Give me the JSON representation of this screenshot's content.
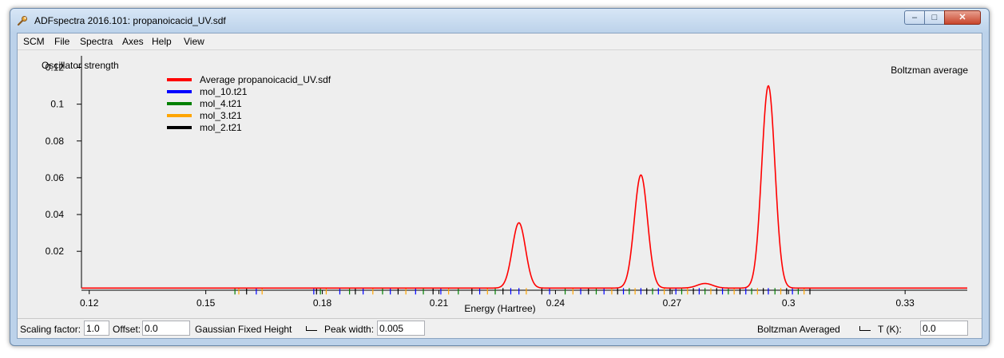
{
  "window": {
    "title": "ADFspectra 2016.101: propanoicacid_UV.sdf"
  },
  "window_controls": {
    "minimize": "–",
    "maximize": "□",
    "close": "✕"
  },
  "menu": [
    "SCM",
    "File",
    "Spectra",
    "Axes",
    "Help",
    "View"
  ],
  "icons": {
    "app": "wrench-icon"
  },
  "legend": [
    {
      "label": "Average propanoicacid_UV.sdf",
      "color": "#ff0000"
    },
    {
      "label": "mol_10.t21",
      "color": "#0000ff"
    },
    {
      "label": "mol_4.t21",
      "color": "#008000"
    },
    {
      "label": "mol_3.t21",
      "color": "#ffa500"
    },
    {
      "label": "mol_2.t21",
      "color": "#000000"
    }
  ],
  "plot": {
    "mode_label": "Boltzman average"
  },
  "chart_data": {
    "type": "line",
    "xlabel": "Energy (Hartree)",
    "ylabel": "Oscillator strength",
    "xlim": [
      0.118,
      0.346
    ],
    "ylim": [
      -0.0055,
      0.125
    ],
    "xticks": [
      "0.12",
      "0.15",
      "0.18",
      "0.21",
      "0.24",
      "0.27",
      "0.3",
      "0.33"
    ],
    "xtick_values": [
      0.12,
      0.15,
      0.18,
      0.21,
      0.24,
      0.27,
      0.3,
      0.33
    ],
    "yticks": [
      "0.02",
      "0.04",
      "0.06",
      "0.08",
      "0.1",
      "0.12"
    ],
    "ytick_values": [
      0.02,
      0.04,
      0.06,
      0.08,
      0.1,
      0.12
    ],
    "baseline": 0.0,
    "series": [
      {
        "name": "Average propanoicacid_UV.sdf",
        "color": "#ff0000",
        "peaks": [
          {
            "center": 0.2306,
            "height": 0.0355,
            "sigma": 0.0017
          },
          {
            "center": 0.262,
            "height": 0.0615,
            "sigma": 0.0017
          },
          {
            "center": 0.2785,
            "height": 0.0025,
            "sigma": 0.002
          },
          {
            "center": 0.2948,
            "height": 0.11,
            "sigma": 0.0017
          }
        ],
        "line_start": 0.118,
        "line_end": 0.346
      }
    ],
    "stick_lines": {
      "x": [
        0.1575,
        0.1585,
        0.1605,
        0.163,
        0.1645,
        0.1778,
        0.1785,
        0.1795,
        0.181,
        0.1845,
        0.187,
        0.1885,
        0.1905,
        0.193,
        0.1955,
        0.1975,
        0.1995,
        0.2015,
        0.204,
        0.206,
        0.2085,
        0.2105,
        0.2125,
        0.215,
        0.2185,
        0.2205,
        0.2225,
        0.2245,
        0.2265,
        0.2285,
        0.2306,
        0.2325,
        0.2365,
        0.2385,
        0.2425,
        0.2445,
        0.2465,
        0.2485,
        0.2505,
        0.2525,
        0.2545,
        0.256,
        0.2575,
        0.259,
        0.2605,
        0.262,
        0.2635,
        0.265,
        0.2665,
        0.268,
        0.2695,
        0.271,
        0.2725,
        0.274,
        0.2755,
        0.277,
        0.2785,
        0.28,
        0.2815,
        0.283,
        0.2845,
        0.286,
        0.2875,
        0.289,
        0.2905,
        0.292,
        0.2935,
        0.2948,
        0.2965,
        0.298,
        0.2995,
        0.301,
        0.3025,
        0.304,
        0.3055
      ],
      "colors": [
        "#008000",
        "#ffa500",
        "#000000",
        "#0000ff",
        "#ffa500",
        "#0000ff",
        "#000000",
        "#008000",
        "#ffa500",
        "#0000ff",
        "#008000",
        "#000000",
        "#0000ff",
        "#ffa500",
        "#008000",
        "#0000ff",
        "#000000",
        "#ffa500",
        "#0000ff",
        "#008000",
        "#000000",
        "#0000ff",
        "#ffa500",
        "#008000",
        "#000000",
        "#0000ff",
        "#ffa500",
        "#008000",
        "#000000",
        "#0000ff",
        "#0000ff",
        "#ffa500",
        "#000000",
        "#0000ff",
        "#008000",
        "#ffa500",
        "#0000ff",
        "#000000",
        "#008000",
        "#0000ff",
        "#ffa500",
        "#000000",
        "#0000ff",
        "#008000",
        "#ffa500",
        "#0000ff",
        "#000000",
        "#008000",
        "#0000ff",
        "#ffa500",
        "#000000",
        "#0000ff",
        "#008000",
        "#ffa500",
        "#000000",
        "#0000ff",
        "#008000",
        "#ffa500",
        "#000000",
        "#0000ff",
        "#008000",
        "#ffa500",
        "#000000",
        "#0000ff",
        "#008000",
        "#ffa500",
        "#000000",
        "#0000ff",
        "#008000",
        "#ffa500",
        "#000000",
        "#0000ff",
        "#008000",
        "#ffa500",
        "#000000"
      ]
    }
  },
  "status": {
    "scaling_label": "Scaling factor:",
    "scaling_value": "1.0",
    "offset_label": "Offset:",
    "offset_value": "0.0",
    "gaussian_label": "Gaussian Fixed Height",
    "peak_width_label": "Peak width:",
    "peak_width_value": "0.005",
    "boltzman_label": "Boltzman Averaged",
    "temp_label": "T (K):",
    "temp_value": "0.0"
  }
}
